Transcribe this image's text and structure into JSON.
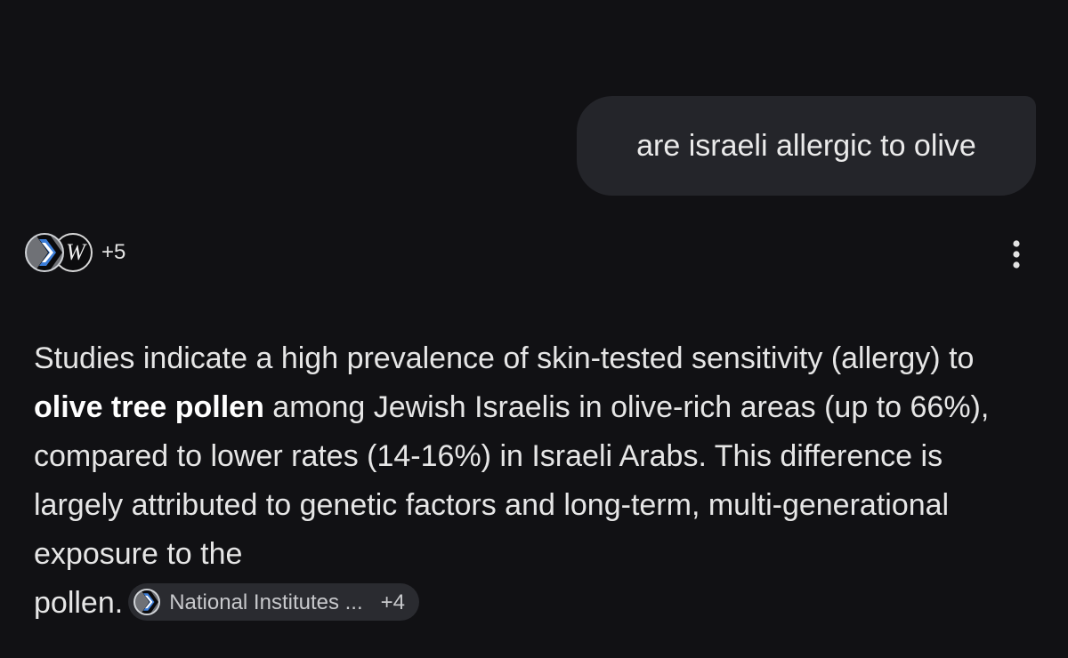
{
  "conversation": {
    "user_message": "are israeli allergic to olive"
  },
  "sources": {
    "icons": [
      "nih-icon",
      "wikipedia-icon"
    ],
    "more_count": "+5"
  },
  "menu": {
    "icon": "more-vert-icon"
  },
  "answer": {
    "text_1": "Studies indicate a high prevalence of skin-tested sensitivity (allergy) to ",
    "bold": "olive tree pollen",
    "text_2": " among Jewish Israelis in olive-rich areas (up to 66%), compared to lower rates (14-16%) in Israeli Arabs. This difference is largely attributed to genetic factors and long-term, multi-generational exposure to the ",
    "text_3": "pollen.",
    "citation": {
      "label": "National Institutes ...",
      "count": "+4"
    }
  },
  "colors": {
    "background": "#111114",
    "bubble": "#24252a",
    "chip": "#2a2b30"
  }
}
